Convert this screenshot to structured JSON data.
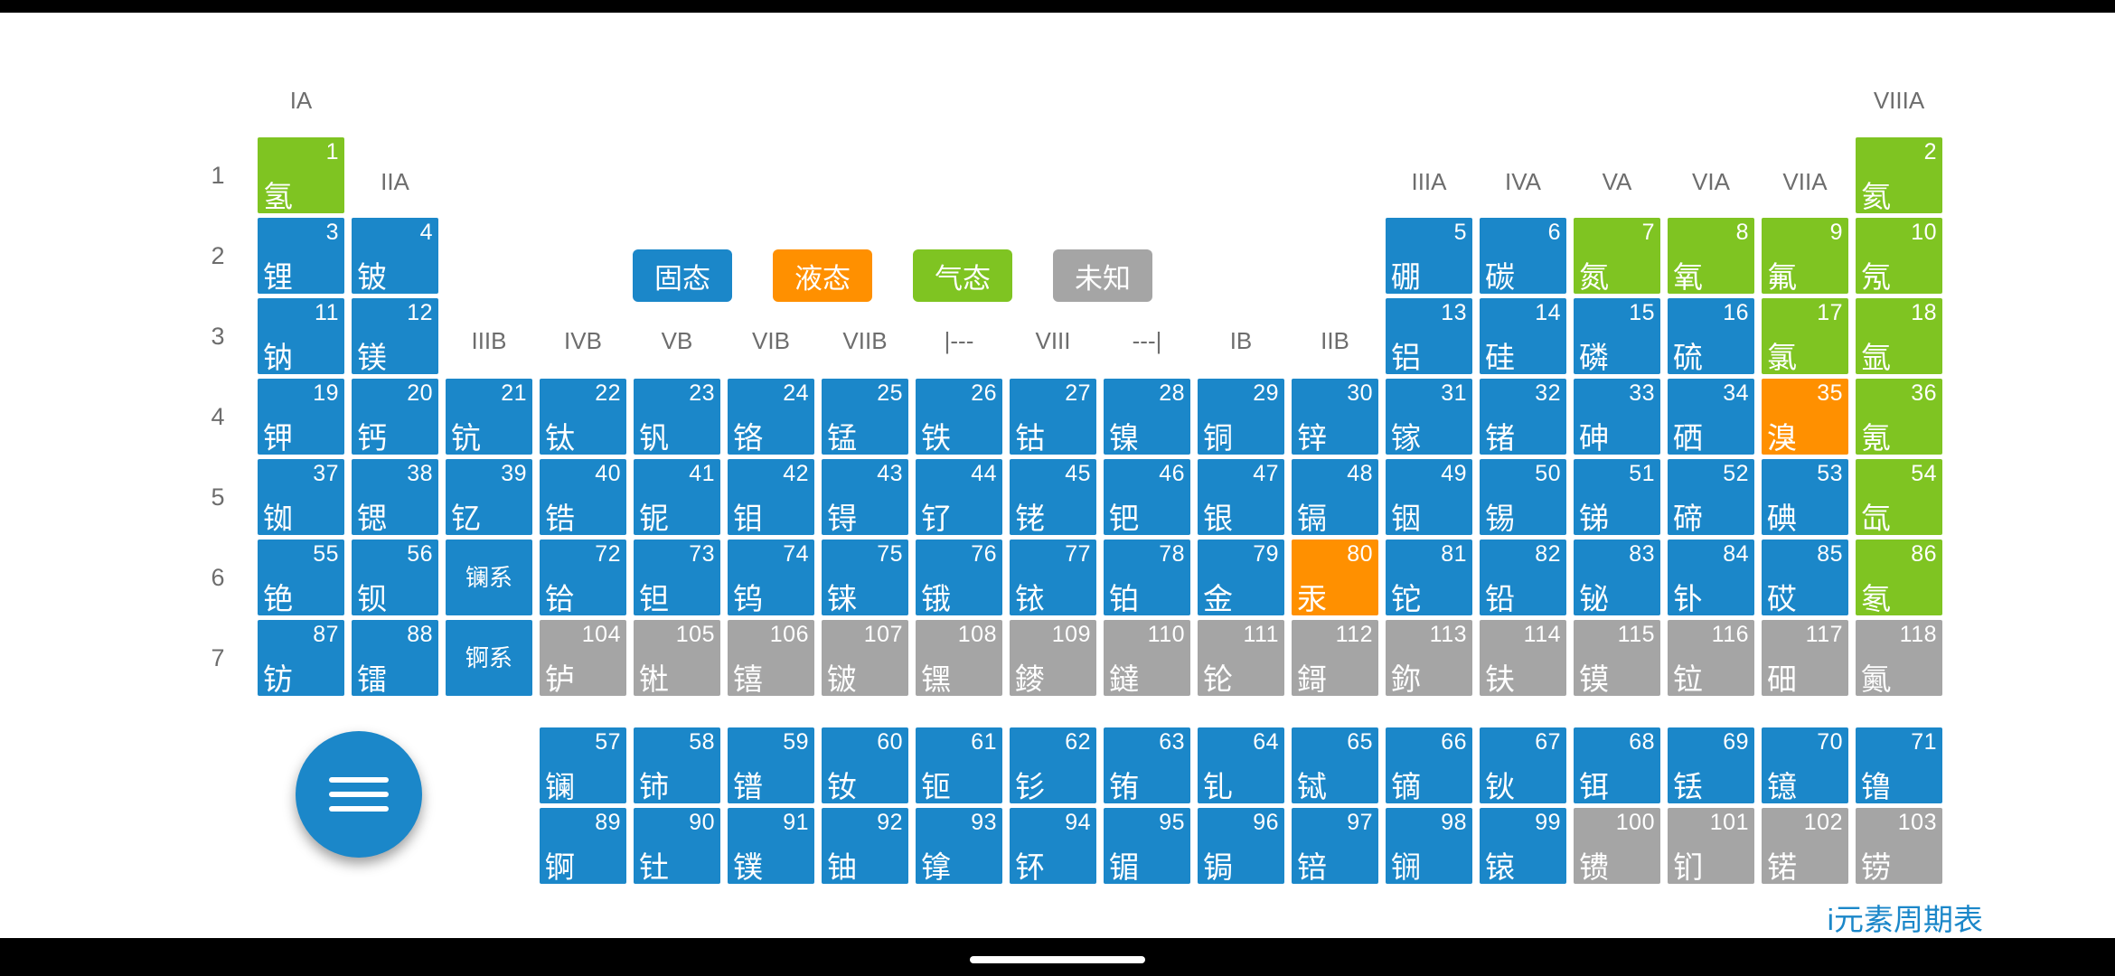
{
  "app": {
    "watermark": "i元素周期表",
    "menu_button": "menu-fab"
  },
  "legend": [
    {
      "label": "固态",
      "state": "solid",
      "color": "#1b87c9"
    },
    {
      "label": "液态",
      "state": "liquid",
      "color": "#ff9000"
    },
    {
      "label": "气态",
      "state": "gas",
      "color": "#7fc422"
    },
    {
      "label": "未知",
      "state": "unknown",
      "color": "#a5a5a5"
    }
  ],
  "group_headers": [
    {
      "label": "IA",
      "col": 1
    },
    {
      "label": "IIA",
      "col": 2
    },
    {
      "label": "IIIB",
      "col": 3
    },
    {
      "label": "IVB",
      "col": 4
    },
    {
      "label": "VB",
      "col": 5
    },
    {
      "label": "VIB",
      "col": 6
    },
    {
      "label": "VIIB",
      "col": 7
    },
    {
      "label": "|---",
      "col": 8
    },
    {
      "label": "VIII",
      "col": 9
    },
    {
      "label": "---|",
      "col": 10
    },
    {
      "label": "IB",
      "col": 11
    },
    {
      "label": "IIB",
      "col": 12
    },
    {
      "label": "IIIA",
      "col": 13
    },
    {
      "label": "IVA",
      "col": 14
    },
    {
      "label": "VA",
      "col": 15
    },
    {
      "label": "VIA",
      "col": 16
    },
    {
      "label": "VIIA",
      "col": 17
    },
    {
      "label": "VIIIA",
      "col": 18
    }
  ],
  "period_headers": [
    "1",
    "2",
    "3",
    "4",
    "5",
    "6",
    "7"
  ],
  "series_cells": [
    {
      "label": "镧系",
      "row": 6,
      "col": 3,
      "state": "solid"
    },
    {
      "label": "锕系",
      "row": 7,
      "col": 3,
      "state": "solid"
    }
  ],
  "elements": [
    {
      "n": 1,
      "name": "氢",
      "row": 1,
      "col": 1,
      "state": "gas"
    },
    {
      "n": 2,
      "name": "氦",
      "row": 1,
      "col": 18,
      "state": "gas"
    },
    {
      "n": 3,
      "name": "锂",
      "row": 2,
      "col": 1,
      "state": "solid"
    },
    {
      "n": 4,
      "name": "铍",
      "row": 2,
      "col": 2,
      "state": "solid"
    },
    {
      "n": 5,
      "name": "硼",
      "row": 2,
      "col": 13,
      "state": "solid"
    },
    {
      "n": 6,
      "name": "碳",
      "row": 2,
      "col": 14,
      "state": "solid"
    },
    {
      "n": 7,
      "name": "氮",
      "row": 2,
      "col": 15,
      "state": "gas"
    },
    {
      "n": 8,
      "name": "氧",
      "row": 2,
      "col": 16,
      "state": "gas"
    },
    {
      "n": 9,
      "name": "氟",
      "row": 2,
      "col": 17,
      "state": "gas"
    },
    {
      "n": 10,
      "name": "氖",
      "row": 2,
      "col": 18,
      "state": "gas"
    },
    {
      "n": 11,
      "name": "钠",
      "row": 3,
      "col": 1,
      "state": "solid"
    },
    {
      "n": 12,
      "name": "镁",
      "row": 3,
      "col": 2,
      "state": "solid"
    },
    {
      "n": 13,
      "name": "铝",
      "row": 3,
      "col": 13,
      "state": "solid"
    },
    {
      "n": 14,
      "name": "硅",
      "row": 3,
      "col": 14,
      "state": "solid"
    },
    {
      "n": 15,
      "name": "磷",
      "row": 3,
      "col": 15,
      "state": "solid"
    },
    {
      "n": 16,
      "name": "硫",
      "row": 3,
      "col": 16,
      "state": "solid"
    },
    {
      "n": 17,
      "name": "氯",
      "row": 3,
      "col": 17,
      "state": "gas"
    },
    {
      "n": 18,
      "name": "氩",
      "row": 3,
      "col": 18,
      "state": "gas"
    },
    {
      "n": 19,
      "name": "钾",
      "row": 4,
      "col": 1,
      "state": "solid"
    },
    {
      "n": 20,
      "name": "钙",
      "row": 4,
      "col": 2,
      "state": "solid"
    },
    {
      "n": 21,
      "name": "钪",
      "row": 4,
      "col": 3,
      "state": "solid"
    },
    {
      "n": 22,
      "name": "钛",
      "row": 4,
      "col": 4,
      "state": "solid"
    },
    {
      "n": 23,
      "name": "钒",
      "row": 4,
      "col": 5,
      "state": "solid"
    },
    {
      "n": 24,
      "name": "铬",
      "row": 4,
      "col": 6,
      "state": "solid"
    },
    {
      "n": 25,
      "name": "锰",
      "row": 4,
      "col": 7,
      "state": "solid"
    },
    {
      "n": 26,
      "name": "铁",
      "row": 4,
      "col": 8,
      "state": "solid"
    },
    {
      "n": 27,
      "name": "钴",
      "row": 4,
      "col": 9,
      "state": "solid"
    },
    {
      "n": 28,
      "name": "镍",
      "row": 4,
      "col": 10,
      "state": "solid"
    },
    {
      "n": 29,
      "name": "铜",
      "row": 4,
      "col": 11,
      "state": "solid"
    },
    {
      "n": 30,
      "name": "锌",
      "row": 4,
      "col": 12,
      "state": "solid"
    },
    {
      "n": 31,
      "name": "镓",
      "row": 4,
      "col": 13,
      "state": "solid"
    },
    {
      "n": 32,
      "name": "锗",
      "row": 4,
      "col": 14,
      "state": "solid"
    },
    {
      "n": 33,
      "name": "砷",
      "row": 4,
      "col": 15,
      "state": "solid"
    },
    {
      "n": 34,
      "name": "硒",
      "row": 4,
      "col": 16,
      "state": "solid"
    },
    {
      "n": 35,
      "name": "溴",
      "row": 4,
      "col": 17,
      "state": "liquid"
    },
    {
      "n": 36,
      "name": "氪",
      "row": 4,
      "col": 18,
      "state": "gas"
    },
    {
      "n": 37,
      "name": "铷",
      "row": 5,
      "col": 1,
      "state": "solid"
    },
    {
      "n": 38,
      "name": "锶",
      "row": 5,
      "col": 2,
      "state": "solid"
    },
    {
      "n": 39,
      "name": "钇",
      "row": 5,
      "col": 3,
      "state": "solid"
    },
    {
      "n": 40,
      "name": "锆",
      "row": 5,
      "col": 4,
      "state": "solid"
    },
    {
      "n": 41,
      "name": "铌",
      "row": 5,
      "col": 5,
      "state": "solid"
    },
    {
      "n": 42,
      "name": "钼",
      "row": 5,
      "col": 6,
      "state": "solid"
    },
    {
      "n": 43,
      "name": "锝",
      "row": 5,
      "col": 7,
      "state": "solid"
    },
    {
      "n": 44,
      "name": "钌",
      "row": 5,
      "col": 8,
      "state": "solid"
    },
    {
      "n": 45,
      "name": "铑",
      "row": 5,
      "col": 9,
      "state": "solid"
    },
    {
      "n": 46,
      "name": "钯",
      "row": 5,
      "col": 10,
      "state": "solid"
    },
    {
      "n": 47,
      "name": "银",
      "row": 5,
      "col": 11,
      "state": "solid"
    },
    {
      "n": 48,
      "name": "镉",
      "row": 5,
      "col": 12,
      "state": "solid"
    },
    {
      "n": 49,
      "name": "铟",
      "row": 5,
      "col": 13,
      "state": "solid"
    },
    {
      "n": 50,
      "name": "锡",
      "row": 5,
      "col": 14,
      "state": "solid"
    },
    {
      "n": 51,
      "name": "锑",
      "row": 5,
      "col": 15,
      "state": "solid"
    },
    {
      "n": 52,
      "name": "碲",
      "row": 5,
      "col": 16,
      "state": "solid"
    },
    {
      "n": 53,
      "name": "碘",
      "row": 5,
      "col": 17,
      "state": "solid"
    },
    {
      "n": 54,
      "name": "氙",
      "row": 5,
      "col": 18,
      "state": "gas"
    },
    {
      "n": 55,
      "name": "铯",
      "row": 6,
      "col": 1,
      "state": "solid"
    },
    {
      "n": 56,
      "name": "钡",
      "row": 6,
      "col": 2,
      "state": "solid"
    },
    {
      "n": 72,
      "name": "铪",
      "row": 6,
      "col": 4,
      "state": "solid"
    },
    {
      "n": 73,
      "name": "钽",
      "row": 6,
      "col": 5,
      "state": "solid"
    },
    {
      "n": 74,
      "name": "钨",
      "row": 6,
      "col": 6,
      "state": "solid"
    },
    {
      "n": 75,
      "name": "铼",
      "row": 6,
      "col": 7,
      "state": "solid"
    },
    {
      "n": 76,
      "name": "锇",
      "row": 6,
      "col": 8,
      "state": "solid"
    },
    {
      "n": 77,
      "name": "铱",
      "row": 6,
      "col": 9,
      "state": "solid"
    },
    {
      "n": 78,
      "name": "铂",
      "row": 6,
      "col": 10,
      "state": "solid"
    },
    {
      "n": 79,
      "name": "金",
      "row": 6,
      "col": 11,
      "state": "solid"
    },
    {
      "n": 80,
      "name": "汞",
      "row": 6,
      "col": 12,
      "state": "liquid"
    },
    {
      "n": 81,
      "name": "铊",
      "row": 6,
      "col": 13,
      "state": "solid"
    },
    {
      "n": 82,
      "name": "铅",
      "row": 6,
      "col": 14,
      "state": "solid"
    },
    {
      "n": 83,
      "name": "铋",
      "row": 6,
      "col": 15,
      "state": "solid"
    },
    {
      "n": 84,
      "name": "钋",
      "row": 6,
      "col": 16,
      "state": "solid"
    },
    {
      "n": 85,
      "name": "砹",
      "row": 6,
      "col": 17,
      "state": "solid"
    },
    {
      "n": 86,
      "name": "氡",
      "row": 6,
      "col": 18,
      "state": "gas"
    },
    {
      "n": 87,
      "name": "钫",
      "row": 7,
      "col": 1,
      "state": "solid"
    },
    {
      "n": 88,
      "name": "镭",
      "row": 7,
      "col": 2,
      "state": "solid"
    },
    {
      "n": 104,
      "name": "𬬻",
      "row": 7,
      "col": 4,
      "state": "unknown"
    },
    {
      "n": 105,
      "name": "𬭊",
      "row": 7,
      "col": 5,
      "state": "unknown"
    },
    {
      "n": 106,
      "name": "𬭳",
      "row": 7,
      "col": 6,
      "state": "unknown"
    },
    {
      "n": 107,
      "name": "𬭛",
      "row": 7,
      "col": 7,
      "state": "unknown"
    },
    {
      "n": 108,
      "name": "𬭶",
      "row": 7,
      "col": 8,
      "state": "unknown"
    },
    {
      "n": 109,
      "name": "䥑",
      "row": 7,
      "col": 9,
      "state": "unknown"
    },
    {
      "n": 110,
      "name": "鐽",
      "row": 7,
      "col": 10,
      "state": "unknown"
    },
    {
      "n": 111,
      "name": "𬬭",
      "row": 7,
      "col": 11,
      "state": "unknown"
    },
    {
      "n": 112,
      "name": "鎶",
      "row": 7,
      "col": 12,
      "state": "unknown"
    },
    {
      "n": 113,
      "name": "鉨",
      "row": 7,
      "col": 13,
      "state": "unknown"
    },
    {
      "n": 114,
      "name": "𫓧",
      "row": 7,
      "col": 14,
      "state": "unknown"
    },
    {
      "n": 115,
      "name": "镆",
      "row": 7,
      "col": 15,
      "state": "unknown"
    },
    {
      "n": 116,
      "name": "𫟷",
      "row": 7,
      "col": 16,
      "state": "unknown"
    },
    {
      "n": 117,
      "name": "鿬",
      "row": 7,
      "col": 17,
      "state": "unknown"
    },
    {
      "n": 118,
      "name": "鿫",
      "row": 7,
      "col": 18,
      "state": "unknown"
    },
    {
      "n": 57,
      "name": "镧",
      "row": 9,
      "col": 4,
      "state": "solid"
    },
    {
      "n": 58,
      "name": "铈",
      "row": 9,
      "col": 5,
      "state": "solid"
    },
    {
      "n": 59,
      "name": "镨",
      "row": 9,
      "col": 6,
      "state": "solid"
    },
    {
      "n": 60,
      "name": "钕",
      "row": 9,
      "col": 7,
      "state": "solid"
    },
    {
      "n": 61,
      "name": "钷",
      "row": 9,
      "col": 8,
      "state": "solid"
    },
    {
      "n": 62,
      "name": "钐",
      "row": 9,
      "col": 9,
      "state": "solid"
    },
    {
      "n": 63,
      "name": "铕",
      "row": 9,
      "col": 10,
      "state": "solid"
    },
    {
      "n": 64,
      "name": "钆",
      "row": 9,
      "col": 11,
      "state": "solid"
    },
    {
      "n": 65,
      "name": "铽",
      "row": 9,
      "col": 12,
      "state": "solid"
    },
    {
      "n": 66,
      "name": "镝",
      "row": 9,
      "col": 13,
      "state": "solid"
    },
    {
      "n": 67,
      "name": "钬",
      "row": 9,
      "col": 14,
      "state": "solid"
    },
    {
      "n": 68,
      "name": "铒",
      "row": 9,
      "col": 15,
      "state": "solid"
    },
    {
      "n": 69,
      "name": "铥",
      "row": 9,
      "col": 16,
      "state": "solid"
    },
    {
      "n": 70,
      "name": "镱",
      "row": 9,
      "col": 17,
      "state": "solid"
    },
    {
      "n": 71,
      "name": "镥",
      "row": 9,
      "col": 18,
      "state": "solid"
    },
    {
      "n": 89,
      "name": "锕",
      "row": 10,
      "col": 4,
      "state": "solid"
    },
    {
      "n": 90,
      "name": "钍",
      "row": 10,
      "col": 5,
      "state": "solid"
    },
    {
      "n": 91,
      "name": "镤",
      "row": 10,
      "col": 6,
      "state": "solid"
    },
    {
      "n": 92,
      "name": "铀",
      "row": 10,
      "col": 7,
      "state": "solid"
    },
    {
      "n": 93,
      "name": "镎",
      "row": 10,
      "col": 8,
      "state": "solid"
    },
    {
      "n": 94,
      "name": "钚",
      "row": 10,
      "col": 9,
      "state": "solid"
    },
    {
      "n": 95,
      "name": "镅",
      "row": 10,
      "col": 10,
      "state": "solid"
    },
    {
      "n": 96,
      "name": "锔",
      "row": 10,
      "col": 11,
      "state": "solid"
    },
    {
      "n": 97,
      "name": "锫",
      "row": 10,
      "col": 12,
      "state": "solid"
    },
    {
      "n": 98,
      "name": "锎",
      "row": 10,
      "col": 13,
      "state": "solid"
    },
    {
      "n": 99,
      "name": "锿",
      "row": 10,
      "col": 14,
      "state": "solid"
    },
    {
      "n": 100,
      "name": "镄",
      "row": 10,
      "col": 15,
      "state": "unknown"
    },
    {
      "n": 101,
      "name": "钔",
      "row": 10,
      "col": 16,
      "state": "unknown"
    },
    {
      "n": 102,
      "name": "锘",
      "row": 10,
      "col": 17,
      "state": "unknown"
    },
    {
      "n": 103,
      "name": "铹",
      "row": 10,
      "col": 18,
      "state": "unknown"
    }
  ]
}
